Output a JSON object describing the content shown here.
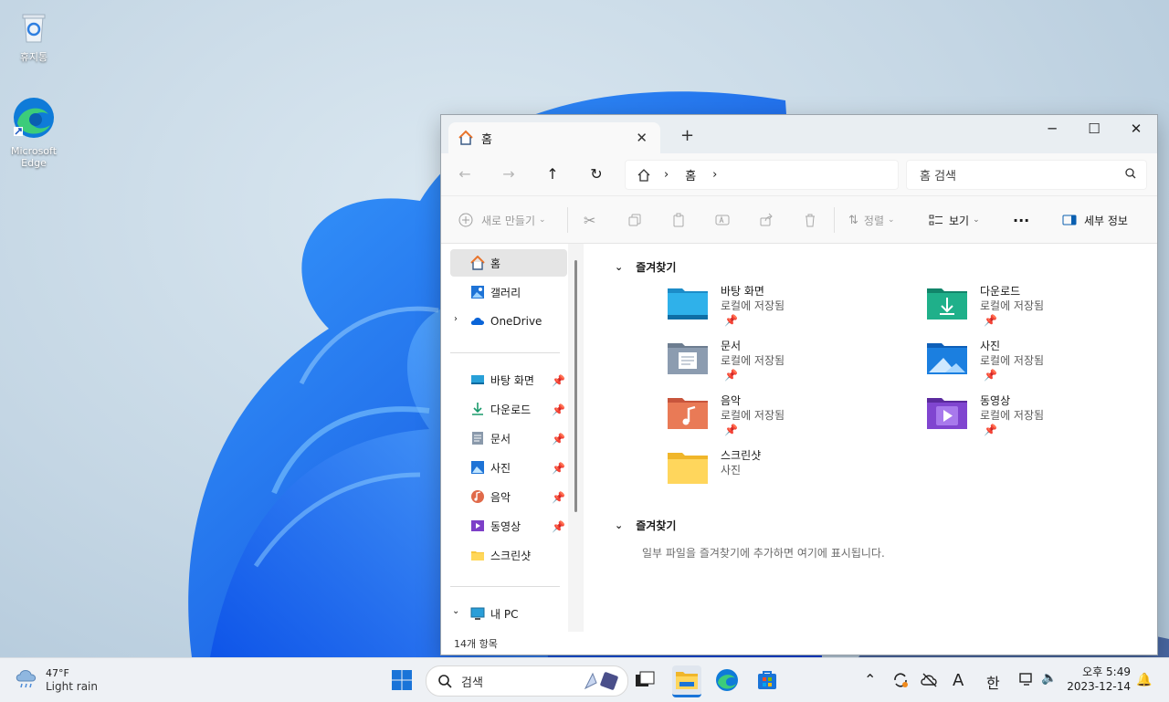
{
  "desktop": {
    "icons": [
      {
        "label": "휴지통"
      },
      {
        "label": "Microsoft Edge"
      }
    ]
  },
  "explorer": {
    "tab": {
      "title": "홈"
    },
    "new_tab": "+",
    "window_controls": {
      "minimize": "─",
      "maximize": "☐",
      "close": "✕"
    },
    "address": {
      "crumb": "홈"
    },
    "search": {
      "placeholder": "홈 검색"
    },
    "toolbar": {
      "new": "새로 만들기",
      "sort": "정렬",
      "view": "보기",
      "more": "···",
      "details": "세부 정보"
    },
    "nav": {
      "home": "홈",
      "gallery": "갤러리",
      "onedrive": "OneDrive",
      "pinned": [
        {
          "label": "바탕 화면"
        },
        {
          "label": "다운로드"
        },
        {
          "label": "문서"
        },
        {
          "label": "사진"
        },
        {
          "label": "음악"
        },
        {
          "label": "동영상"
        },
        {
          "label": "스크린샷"
        }
      ],
      "this_pc": "내 PC"
    },
    "status": "14개 항목",
    "sections": {
      "quick_access": "즐겨찾기",
      "favorites": "즐겨찾기",
      "favorites_empty": "일부 파일을 즐겨찾기에 추가하면 여기에 표시됩니다."
    },
    "folders": [
      {
        "name": "바탕 화면",
        "sub": "로컬에 저장됨"
      },
      {
        "name": "다운로드",
        "sub": "로컬에 저장됨"
      },
      {
        "name": "문서",
        "sub": "로컬에 저장됨"
      },
      {
        "name": "사진",
        "sub": "로컬에 저장됨"
      },
      {
        "name": "음악",
        "sub": "로컬에 저장됨"
      },
      {
        "name": "동영상",
        "sub": "로컬에 저장됨"
      },
      {
        "name": "스크린샷",
        "sub": "사진"
      }
    ]
  },
  "taskbar": {
    "weather": {
      "temp": "47°F",
      "desc": "Light rain"
    },
    "search": {
      "placeholder": "검색"
    },
    "tray": {
      "ime_a": "A",
      "ime_han": "한"
    },
    "clock": {
      "time": "오후 5:49",
      "date": "2023-12-14"
    }
  }
}
